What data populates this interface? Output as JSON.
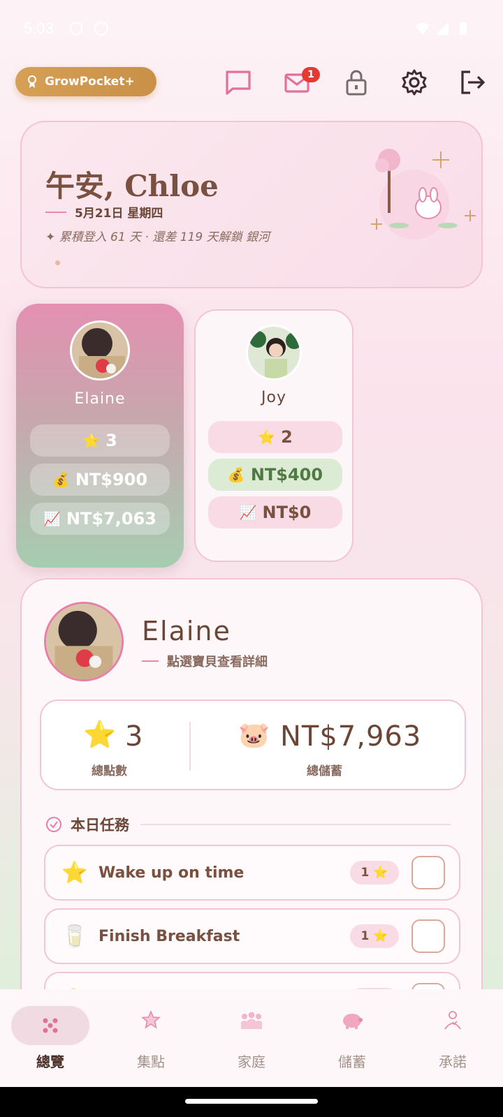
{
  "status": {
    "time": "5:03"
  },
  "topbar": {
    "badge_label": "GrowPocket+",
    "mail_count": "1"
  },
  "greeting": {
    "title": "午安, Chloe",
    "date": "5月21日 星期四",
    "login_info": "✦ 累積登入 61 天 · 還差 119 天解鎖 銀河"
  },
  "kids": [
    {
      "name": "Elaine",
      "stars": "3",
      "savings": "NT$900",
      "invest": "NT$7,063"
    },
    {
      "name": "Joy",
      "stars": "2",
      "savings": "NT$400",
      "invest": "NT$0"
    }
  ],
  "detail": {
    "name": "Elaine",
    "hint": "點選寶貝查看詳細",
    "points_value": "3",
    "points_label": "總點數",
    "savings_value": "NT$7,963",
    "savings_label": "總儲蓄",
    "section_title": "本日任務",
    "tasks": [
      {
        "icon": "star-icon",
        "name": "Wake up on time",
        "points": "1"
      },
      {
        "icon": "milk-icon",
        "name": "Finish Breakfast",
        "points": "1"
      }
    ]
  },
  "nav": [
    {
      "label": "總覽",
      "icon": "overview-icon"
    },
    {
      "label": "集點",
      "icon": "star-badge-icon"
    },
    {
      "label": "家庭",
      "icon": "family-icon"
    },
    {
      "label": "儲蓄",
      "icon": "piggy-bank-icon"
    },
    {
      "label": "承諾",
      "icon": "promise-icon"
    }
  ],
  "colors": {
    "accent_pink": "#e87fa8",
    "brown_text": "#6b4637",
    "gold_badge": "#d6a055",
    "green_pill": "#dcebd4"
  }
}
